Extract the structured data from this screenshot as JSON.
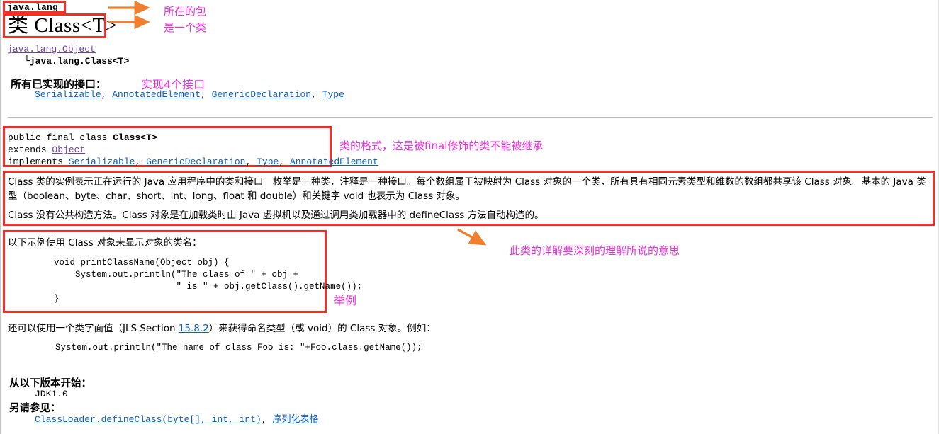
{
  "page": {
    "package": "java.lang",
    "title_prefix": "类",
    "title_name": "Class<T>"
  },
  "hierarchy": {
    "root": "java.lang.Object",
    "branch_glyph": "└",
    "child": "java.lang.Class<T>"
  },
  "interfaces": {
    "heading": "所有已实现的接口：",
    "items": [
      "Serializable",
      "AnnotatedElement",
      "GenericDeclaration",
      "Type"
    ],
    "separator": ", "
  },
  "declaration": {
    "line1_modifiers": "public final class ",
    "line1_name": "Class<T>",
    "line2_keyword": "extends ",
    "line2_type": "Object",
    "line3_keyword": "implements ",
    "line3_types": [
      "Serializable",
      "GenericDeclaration",
      "Type",
      "AnnotatedElement"
    ],
    "separator": ", "
  },
  "description": {
    "paragraph1": "Class 类的实例表示正在运行的 Java 应用程序中的类和接口。枚举是一种类，注释是一种接口。每个数组属于被映射为 Class 对象的一个类，所有具有相同元素类型和维数的数组都共享该 Class 对象。基本的 Java 类型（boolean、byte、char、short、int、long、float 和 double）和关键字 void 也表示为 Class 对象。",
    "paragraph2": "Class 没有公共构造方法。Class 对象是在加载类时由 Java 虚拟机以及通过调用类加载器中的 defineClass 方法自动构造的。"
  },
  "example": {
    "lead": "以下示例使用 Class 对象来显示对象的类名：",
    "code": "void printClassName(Object obj) {\n    System.out.println(\"The class of \" + obj +\n                       \" is \" + obj.getClass().getName());\n}"
  },
  "literal": {
    "text_before": "还可以使用一个类字面值（JLS Section ",
    "link": "15.8.2",
    "text_after": "）来获得命名类型（或 void）的 Class 对象。例如：",
    "code": "System.out.println(\"The name of class Foo is: \"+Foo.class.getName());"
  },
  "footer": {
    "since_heading": "从以下版本开始：",
    "since_value": "JDK1.0",
    "see_heading": "另请参见：",
    "see_items": [
      "ClassLoader.defineClass(byte[], int, int)",
      "序列化表格"
    ],
    "see_separator": ", "
  },
  "annotations": {
    "package_note": "所在的包",
    "class_note": "是一个类",
    "interfaces_note": "实现4个接口",
    "final_note": "类的格式，这是被final修饰的类不能被继承",
    "detail_note": "此类的详解要深刻的理解所说的意思",
    "example_note": "举例"
  },
  "colors": {
    "highlight_box": "#f2302a",
    "annotation_text": "#ef2fe0",
    "arrow": "#f08030",
    "link": "#0b5ec7",
    "link_visited": "#7040a0",
    "divider": "#bdbdbd"
  }
}
